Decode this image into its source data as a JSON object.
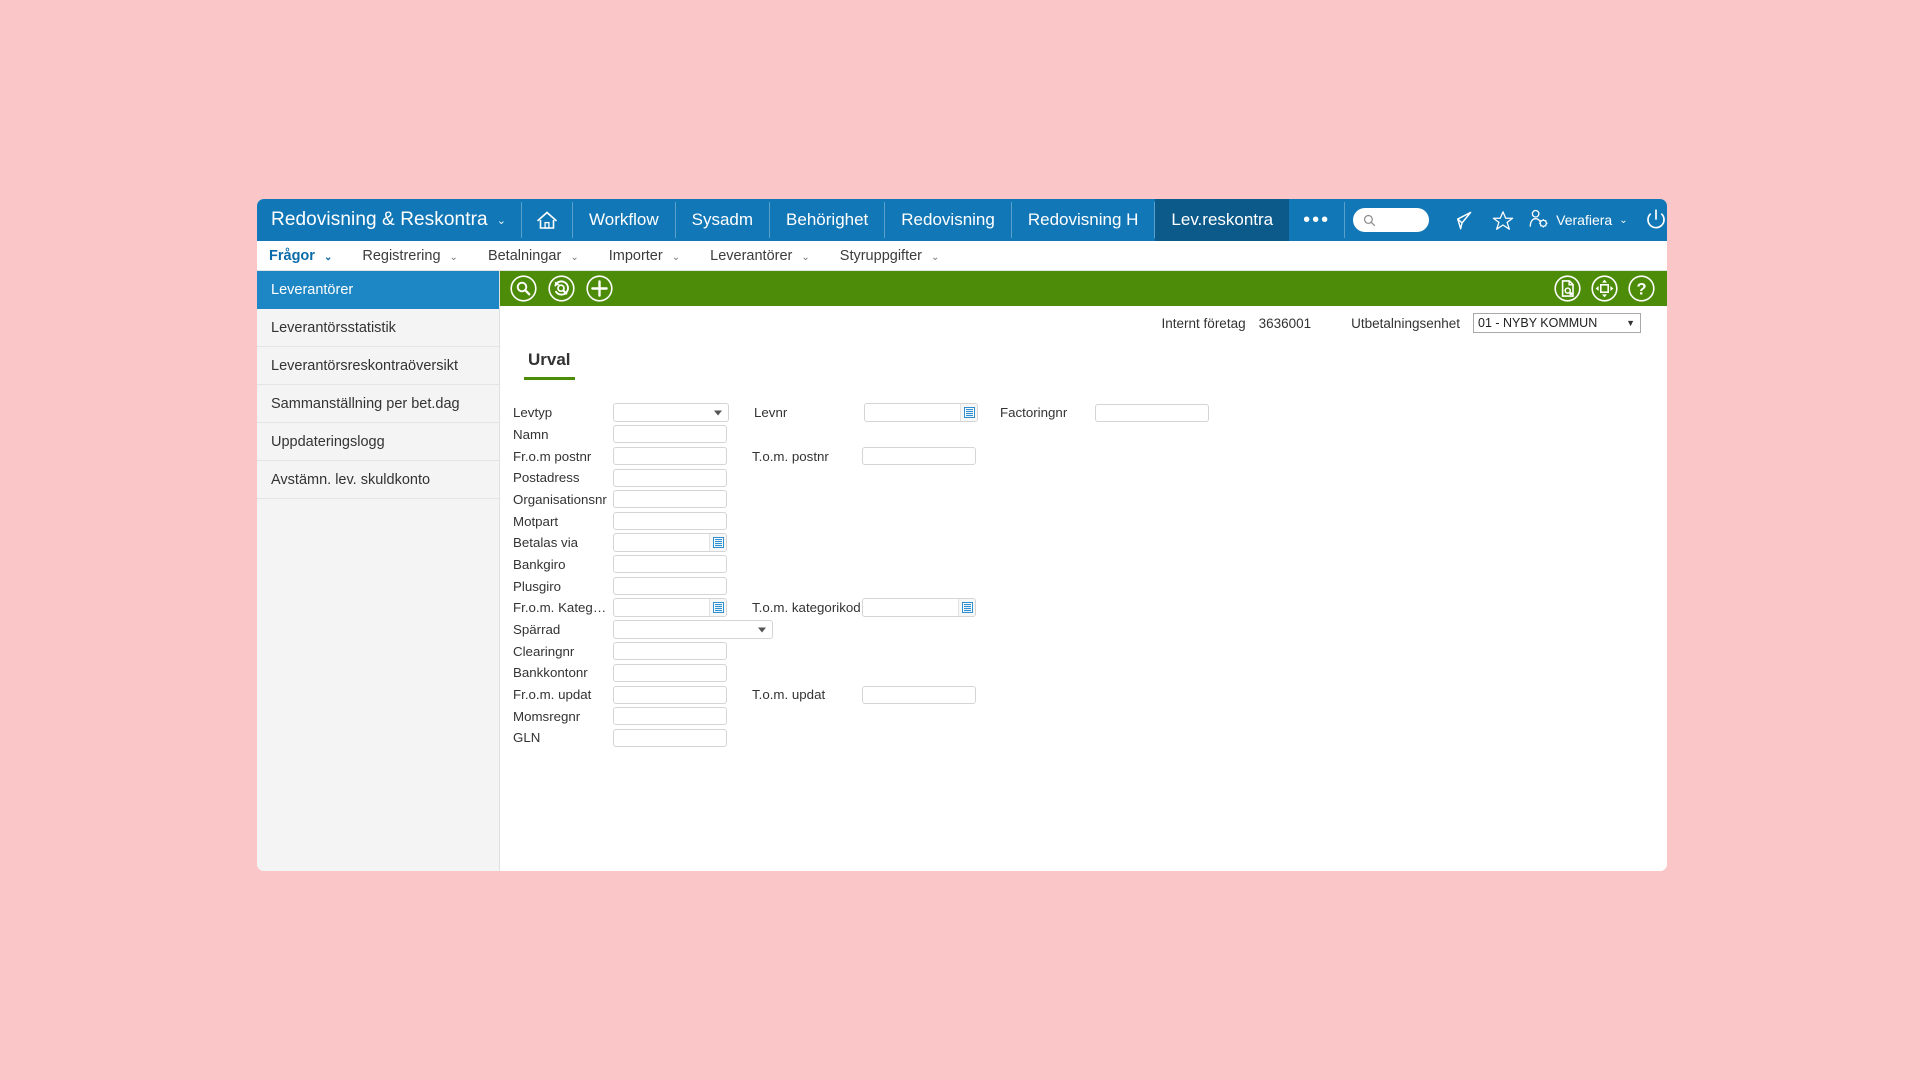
{
  "window": {
    "background_color": "#fbc6c8",
    "nav_color": "#1277b6",
    "nav_active_color": "#0c5a8a",
    "toolbar_color": "#4c8c08",
    "sidebar_active_color": "#1d86c4"
  },
  "primary_nav": {
    "brand": "Redovisning & Reskontra",
    "brand_caret": "⌄",
    "home_icon": "home-icon",
    "items": [
      {
        "label": "Workflow",
        "active": false
      },
      {
        "label": "Sysadm",
        "active": false
      },
      {
        "label": "Behörighet",
        "active": false
      },
      {
        "label": "Redovisning",
        "active": false
      },
      {
        "label": "Redovisning H",
        "active": false
      },
      {
        "label": "Lev.reskontra",
        "active": true
      }
    ],
    "overflow_label": "•••",
    "search": {
      "icon": "search-icon",
      "value": "",
      "placeholder": ""
    },
    "icons": [
      {
        "name": "megaphone-icon"
      },
      {
        "name": "star-icon"
      }
    ],
    "user": {
      "icon": "user-settings-icon",
      "name": "Verafiera",
      "caret": "⌄"
    },
    "power": {
      "icon": "power-icon"
    }
  },
  "secondary_menu": {
    "items": [
      {
        "label": "Frågor",
        "active": true,
        "caret": "⌄"
      },
      {
        "label": "Registrering",
        "active": false,
        "caret": "⌄"
      },
      {
        "label": "Betalningar",
        "active": false,
        "caret": "⌄"
      },
      {
        "label": "Importer",
        "active": false,
        "caret": "⌄"
      },
      {
        "label": "Leverantörer",
        "active": false,
        "caret": "⌄"
      },
      {
        "label": "Styruppgifter",
        "active": false,
        "caret": "⌄"
      }
    ]
  },
  "sidebar": {
    "items": [
      {
        "label": "Leverantörer",
        "active": true
      },
      {
        "label": "Leverantörsstatistik",
        "active": false
      },
      {
        "label": "Leverantörsreskontraöversikt",
        "active": false
      },
      {
        "label": "Sammanställning per bet.dag",
        "active": false
      },
      {
        "label": "Uppdateringslogg",
        "active": false
      },
      {
        "label": "Avstämn. lev. skuldkonto",
        "active": false
      }
    ]
  },
  "green_toolbar": {
    "left_buttons": [
      {
        "name": "search-icon",
        "title": "Sök"
      },
      {
        "name": "search-refresh-icon",
        "title": "Sök om"
      },
      {
        "name": "plus-icon",
        "title": "Ny"
      }
    ],
    "right_buttons": [
      {
        "name": "document-settings-icon",
        "title": "Dokument"
      },
      {
        "name": "move-resize-icon",
        "title": "Flytta"
      },
      {
        "name": "help-icon",
        "title": "Hjälp"
      }
    ]
  },
  "context_row": {
    "company_label": "Internt företag",
    "company_value": "3636001",
    "unit_label": "Utbetalningsenhet",
    "unit_value": "01 - NYBY KOMMUN",
    "unit_arrow": "▼"
  },
  "tabs": [
    {
      "label": "Urval",
      "active": true
    }
  ],
  "form": {
    "rows": [
      {
        "label": "Levtyp",
        "control": "select",
        "value": "",
        "label2": "Levnr",
        "control2": "lookup",
        "value2": "",
        "label3": "Factoringnr",
        "control3": "input",
        "value3": ""
      },
      {
        "label": "Namn",
        "control": "input",
        "value": ""
      },
      {
        "label": "Fr.o.m postnr",
        "control": "input",
        "value": "",
        "label2": "T.o.m. postnr",
        "control2": "input",
        "value2": ""
      },
      {
        "label": "Postadress",
        "control": "input",
        "value": ""
      },
      {
        "label": "Organisationsnr",
        "control": "input",
        "value": ""
      },
      {
        "label": "Motpart",
        "control": "input",
        "value": ""
      },
      {
        "label": "Betalas via",
        "control": "lookup",
        "value": ""
      },
      {
        "label": "Bankgiro",
        "control": "input",
        "value": ""
      },
      {
        "label": "Plusgiro",
        "control": "input",
        "value": ""
      },
      {
        "label": "Fr.o.m. Kategori…",
        "control": "lookup",
        "value": "",
        "label2": "T.o.m. kategorikod",
        "control2": "lookup",
        "value2": ""
      },
      {
        "label": "Spärrad",
        "control": "select-wide",
        "value": ""
      },
      {
        "label": "Clearingnr",
        "control": "input",
        "value": ""
      },
      {
        "label": "Bankkontonr",
        "control": "input",
        "value": ""
      },
      {
        "label": "Fr.o.m. updat",
        "control": "input",
        "value": "",
        "label2": "T.o.m. updat",
        "control2": "input",
        "value2": ""
      },
      {
        "label": "Momsregnr",
        "control": "input",
        "value": ""
      },
      {
        "label": "GLN",
        "control": "input",
        "value": ""
      }
    ]
  }
}
